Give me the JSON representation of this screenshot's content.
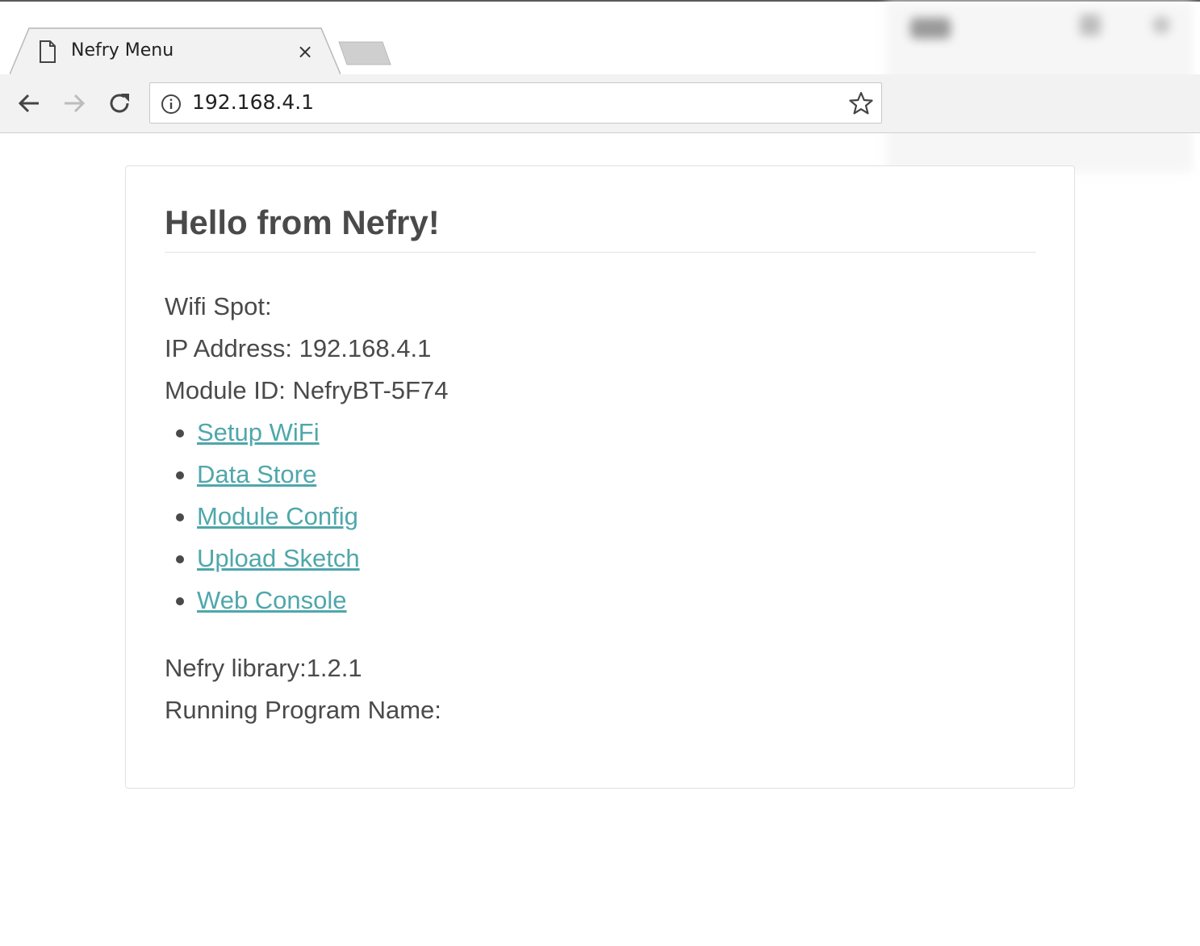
{
  "browser": {
    "tab_title": "Nefry Menu",
    "tab_close_glyph": "×",
    "url": "192.168.4.1",
    "icons": [
      "document-icon",
      "close-icon",
      "back-arrow-icon",
      "forward-arrow-icon",
      "reload-icon",
      "info-icon",
      "star-icon"
    ]
  },
  "page": {
    "heading": "Hello from Nefry!",
    "wifi_spot": "Wifi Spot:",
    "ip_address": "IP Address: 192.168.4.1",
    "module_id": "Module ID: NefryBT-5F74",
    "links": [
      {
        "label": "Setup WiFi"
      },
      {
        "label": "Data Store"
      },
      {
        "label": "Module Config"
      },
      {
        "label": "Upload Sketch"
      },
      {
        "label": "Web Console"
      }
    ],
    "library": "Nefry library:1.2.1",
    "program_name": "Running Program Name:"
  },
  "colors": {
    "link": "#4fa7ab",
    "text": "#4a4a4a",
    "toolbar": "#f2f2f2"
  }
}
